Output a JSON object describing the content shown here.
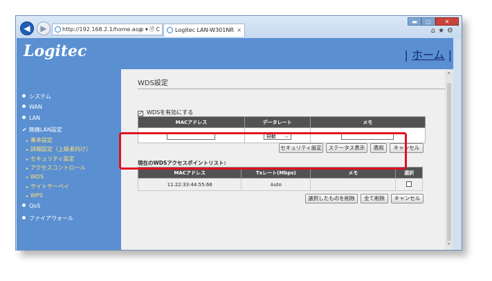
{
  "browser": {
    "address": "http://192.168.2.1/home.asp",
    "address_controls": "ρ ▾ 🗎 C",
    "tab_title": "Logitec LAN-W301NR",
    "tab_close": "×",
    "window_buttons": [
      "▬",
      "▢",
      "✕"
    ],
    "tools_icons": [
      "home-icon",
      "star-icon",
      "gear-icon"
    ]
  },
  "header": {
    "logo": "Logitec",
    "home_link": "ホーム",
    "home_prefix": "|",
    "home_suffix": "|"
  },
  "sidebar": {
    "items": [
      {
        "label": "システム"
      },
      {
        "label": "WAN"
      },
      {
        "label": "LAN"
      },
      {
        "label": "無線LAN設定"
      },
      {
        "label": "QoS"
      },
      {
        "label": "ファイアウォール"
      }
    ],
    "subitems": [
      {
        "label": "基本設定"
      },
      {
        "label": "詳細設定（上級者向け）"
      },
      {
        "label": "セキュリティ設定"
      },
      {
        "label": "アクセスコントロール"
      },
      {
        "label": "WDS"
      },
      {
        "label": "サイトサーベイ"
      },
      {
        "label": "WPS"
      }
    ]
  },
  "main": {
    "title": "WDS設定",
    "enable_label": "WDSを有効にする",
    "enable_checked": true,
    "form_table": {
      "headers": [
        "MACアドレス",
        "データレート",
        "メモ"
      ],
      "rate_value": "自動"
    },
    "buttons1": [
      "セキュリティ設定",
      "ステータス表示",
      "適用",
      "キャンセル"
    ],
    "list_title": "現在のWDSアクセスポイントリスト:",
    "list_table": {
      "headers": [
        "MACアドレス",
        "Txレート(Mbps)",
        "メモ",
        "選択"
      ],
      "rows": [
        {
          "mac": "11:22:33:44:55:66",
          "rate": "Auto",
          "memo": "",
          "selected": false
        }
      ]
    },
    "buttons2": [
      "選択したものを削除",
      "全て削除",
      "キャンセル"
    ]
  },
  "colors": {
    "banner": "#5a8fd1",
    "table_header": "#525252",
    "highlight": "#e0101f",
    "submenu_text": "#ffe27a"
  }
}
